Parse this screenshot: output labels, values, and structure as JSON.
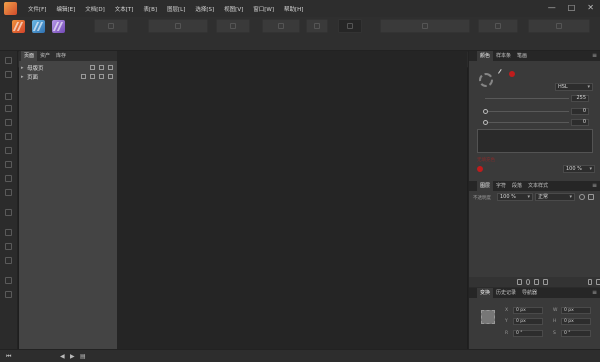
{
  "menu": {
    "items": [
      "文件[F]",
      "编辑[E]",
      "文档[D]",
      "文本[T]",
      "表[B]",
      "图层[L]",
      "选择[S]",
      "视图[V]",
      "窗口[W]",
      "帮助[H]"
    ],
    "window_controls": [
      "—",
      "□",
      "✕"
    ]
  },
  "personas": [
    {
      "name": "publisher-persona",
      "color": "#e06a32"
    },
    {
      "name": "photo-persona",
      "color": "#4a93cc"
    },
    {
      "name": "designer-persona",
      "color": "#9a70d4"
    }
  ],
  "pages_panel": {
    "tabs": [
      "页面",
      "资产",
      "库存"
    ],
    "active_tab": 0,
    "rows": [
      {
        "label": "母版页"
      },
      {
        "label": "页面"
      }
    ]
  },
  "color_panel": {
    "tabs": [
      "颜色",
      "样本条",
      "笔画"
    ],
    "active_tab": 0,
    "mode_label": "HSL",
    "sliders": [
      {
        "value": "255"
      },
      {
        "value": "0"
      },
      {
        "value": "0"
      }
    ],
    "hint": "无填充色",
    "opacity": "100 %"
  },
  "layers_panel": {
    "tabs": [
      "图层",
      "字符",
      "段落",
      "文本样式"
    ],
    "active_tab": 0,
    "opacity_label": "不透明度",
    "opacity": "100 %",
    "blend_mode": "正常"
  },
  "transform_panel": {
    "tabs": [
      "变换",
      "历史记录",
      "导航器"
    ],
    "active_tab": 0,
    "fields": [
      {
        "label": "X",
        "value": "0 px"
      },
      {
        "label": "W",
        "value": "0 px"
      },
      {
        "label": "Y",
        "value": "0 px"
      },
      {
        "label": "H",
        "value": "0 px"
      },
      {
        "label": "R",
        "value": "0 °"
      },
      {
        "label": "S",
        "value": "0 °"
      }
    ]
  },
  "colors": {
    "accent_red": "#c01c1c",
    "panel_bg": "#3a3a3a",
    "canvas_bg": "#252525"
  }
}
